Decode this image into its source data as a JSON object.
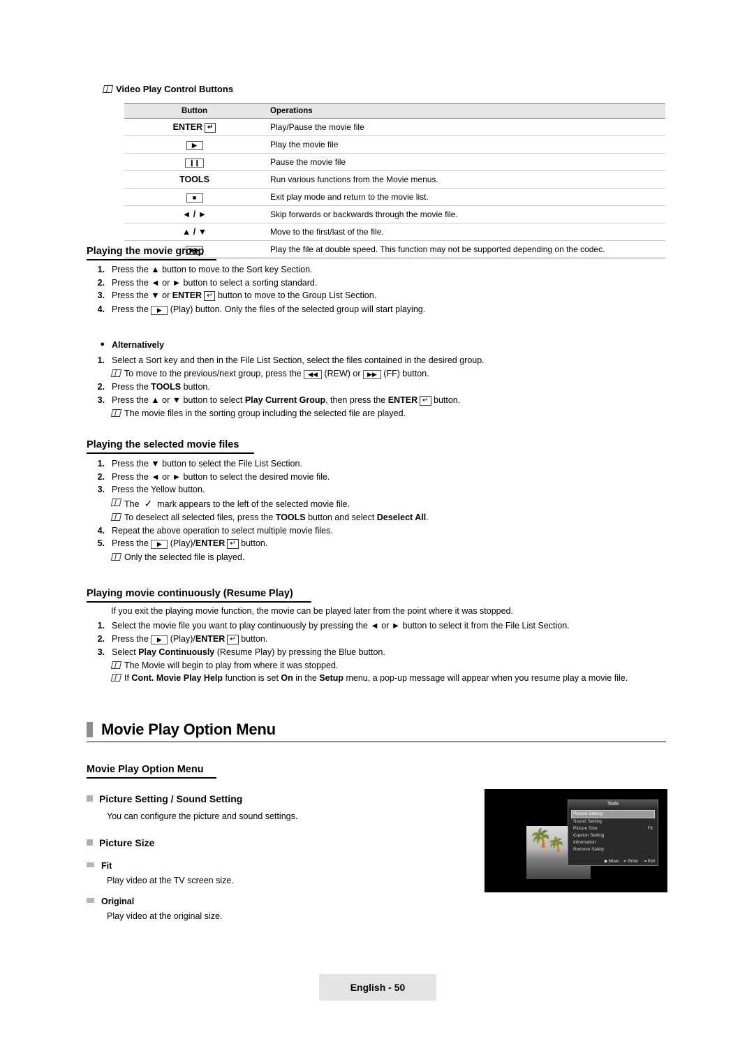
{
  "top_note": "Video Play Control Buttons",
  "table": {
    "headers": [
      "Button",
      "Operations"
    ],
    "rows": [
      {
        "button": "ENTER",
        "button_glyph": "enter",
        "operation": "Play/Pause the movie file"
      },
      {
        "button": "",
        "button_glyph": "play",
        "operation": "Play the movie file"
      },
      {
        "button": "",
        "button_glyph": "pause",
        "operation": "Pause the movie file"
      },
      {
        "button": "TOOLS",
        "button_glyph": "text",
        "operation": "Run various functions from the Movie menus."
      },
      {
        "button": "",
        "button_glyph": "stop",
        "operation": "Exit play mode and return to the movie list."
      },
      {
        "button": "◄ / ►",
        "button_glyph": "arrows-lr",
        "operation": "Skip forwards or backwards through the movie file."
      },
      {
        "button": "▲ / ▼",
        "button_glyph": "arrows-ud",
        "operation": "Move to the first/last of the file."
      },
      {
        "button": "",
        "button_glyph": "fastforward",
        "operation": "Play the file at double speed. This function may not be supported depending on the codec."
      }
    ]
  },
  "section1": {
    "heading": "Playing the movie group",
    "items": [
      {
        "num": "1.",
        "parts": [
          {
            "t": "Press the "
          },
          {
            "t": "▲",
            "b": false
          },
          {
            "t": " button to move to the Sort key Section."
          }
        ]
      },
      {
        "num": "2.",
        "parts": [
          {
            "t": "Press the ◄ or ► button to select a sorting standard."
          }
        ]
      },
      {
        "num": "3.",
        "parts": [
          {
            "t": "Press the ▼ or "
          },
          {
            "t": "ENTER",
            "b": true
          },
          {
            "t": "E"
          },
          {
            "t": " button to move to the Group List Section."
          }
        ]
      },
      {
        "num": "4.",
        "parts": [
          {
            "t": "Press the "
          },
          {
            "t": "[▶]"
          },
          {
            "t": " (Play) button. Only the files of the selected group will start playing."
          }
        ]
      }
    ],
    "alt_heading": "Alternatively",
    "alt_items": [
      {
        "num": "1.",
        "text": "Select a Sort key and then in the File List Section, select the files contained in the desired group."
      },
      {
        "note": "To move to the previous/next group, press the ◄◄ (REW) or ►► (FF) button."
      },
      {
        "num": "2.",
        "text": "Press the TOOLS button."
      },
      {
        "num": "3.",
        "text": "Press the ▲ or ▼ button to select Play Current Group, then press the ENTER E button."
      },
      {
        "note": "The movie files in the sorting group including the selected file are played."
      }
    ]
  },
  "section2": {
    "heading": "Playing the selected movie files",
    "items": [
      {
        "num": "1.",
        "text": "Press the ▼ button to select the File List Section."
      },
      {
        "num": "2.",
        "text": "Press the ◄ or ► button to select the desired movie file."
      },
      {
        "num": "3.",
        "text": "Press the Yellow button."
      },
      {
        "note": "The ✓ mark appears to the left of the selected movie file."
      },
      {
        "note2": "To deselect all selected files, press the TOOLS button and select Deselect All."
      },
      {
        "num": "4.",
        "text": "Repeat the above operation to select multiple movie files."
      },
      {
        "num": "5.",
        "text": "Press the [▶] (Play)/ENTER E button."
      },
      {
        "note3": "Only the selected file is played."
      }
    ]
  },
  "section3": {
    "heading": "Playing movie continuously (Resume Play)",
    "intro": "If you exit the playing movie function, the movie can be played later from the point where it was stopped.",
    "items": [
      {
        "num": "1.",
        "text": "Select the movie file you want to play continuously by pressing the ◄ or ► button to select it from the File List Section."
      },
      {
        "num": "2.",
        "text": "Press the [▶] (Play)/ENTER E button."
      },
      {
        "num": "3.",
        "text": "Select Play Continuously (Resume Play) by pressing the Blue button."
      },
      {
        "note": "The Movie will begin to play from where it was stopped."
      },
      {
        "note2": "If Cont. Movie Play Help function is set On in the Setup menu, a pop-up message will appear when you resume play a movie file."
      }
    ]
  },
  "chapter_title": "Movie Play Option Menu",
  "option_section": {
    "heading": "Movie Play Option Menu",
    "item1": "Picture Setting / Sound Setting",
    "item1_desc": "You can configure the picture and sound settings.",
    "item2": "Picture Size",
    "sub1": "Fit",
    "sub1_desc": "Play video at the TV screen size.",
    "sub2": "Original",
    "sub2_desc": "Play video at the original size."
  },
  "tv_screen": {
    "menu_title": "Tools",
    "menu_items": [
      {
        "label": "Picture Setting",
        "value": "",
        "selected": true
      },
      {
        "label": "Sound Setting",
        "value": "",
        "selected": false
      },
      {
        "label": "Picture Size",
        "value": "Fit",
        "sep": ":",
        "selected": false
      },
      {
        "label": "Caption Setting",
        "value": "",
        "selected": false
      },
      {
        "label": "Information",
        "value": "",
        "selected": false
      },
      {
        "label": "Remove Safely",
        "value": "",
        "selected": false
      }
    ],
    "footer": [
      "Move",
      "Enter",
      "Exit"
    ]
  },
  "footer": "English - 50"
}
